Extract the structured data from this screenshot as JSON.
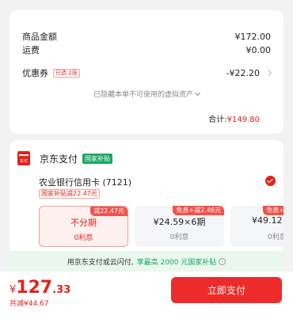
{
  "summary": {
    "goods_label": "商品金额",
    "goods_value": "¥172.00",
    "shipping_label": "运费",
    "shipping_value": "¥0.00",
    "coupon_label": "优惠券",
    "coupon_tag": "已选 2张",
    "coupon_value": "-¥22.20",
    "hidden_note": "已隐藏本单不可使用的虚拟资产",
    "total_label": "合计:",
    "total_value": "¥149.80"
  },
  "payment": {
    "method_title": "京东支付",
    "logo_text": "东付",
    "gov_badge": "国家补贴",
    "bank_name": "农业银行信用卡 (7121)",
    "bank_sub": "国家补贴减22.47元",
    "plans": [
      {
        "title": "不分期",
        "sub": "0利息",
        "tag": "减22.47元",
        "selected": true
      },
      {
        "title": "¥24.59×6期",
        "sub": "0利息",
        "tag": "免息+减2.46元",
        "selected": false
      },
      {
        "title": "¥49.12×",
        "sub": "0利息",
        "tag": "免息+减",
        "selected": false
      }
    ],
    "banner_text": "用京东支付或云闪付,",
    "banner_highlight": "享最高 2000 元国家补贴",
    "banner_info_icon": "i"
  },
  "footer": {
    "currency": "¥",
    "price_int": "127",
    "price_dec": ".33",
    "saved": "共减¥44.67",
    "pay_button": "立即支付"
  },
  "colors": {
    "accent": "#e2231a",
    "green": "#1aa760"
  }
}
